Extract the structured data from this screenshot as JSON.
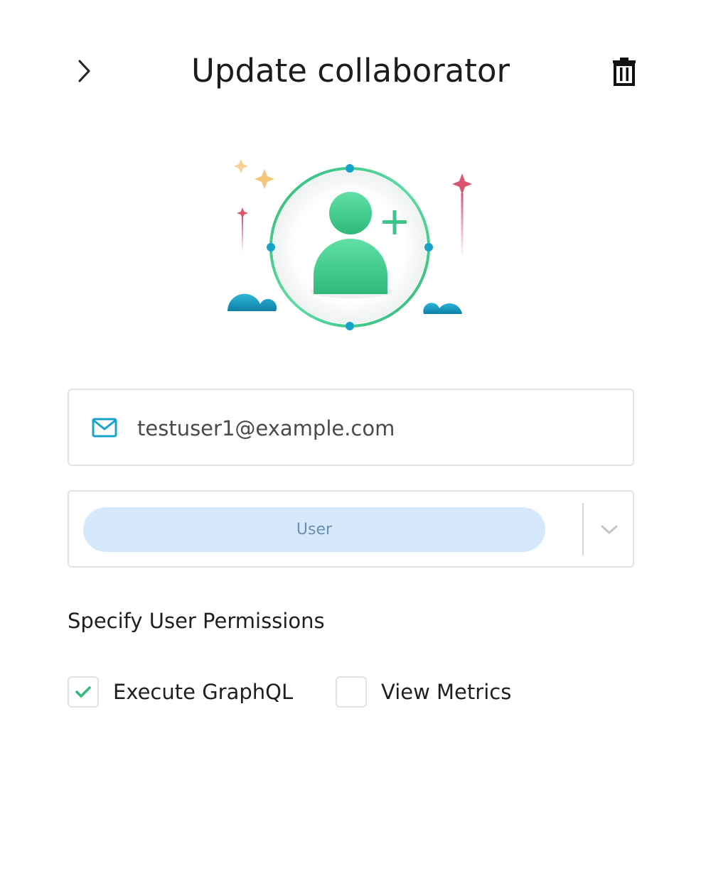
{
  "header": {
    "title": "Update collaborator",
    "back_icon": "chevron-right-icon",
    "delete_icon": "trash-icon"
  },
  "illustration": {
    "icon": "add-user-icon",
    "colors": {
      "green": "#3cc68a",
      "teal": "#1aa3c9",
      "pink": "#d9566e",
      "gold": "#f4c77a"
    }
  },
  "email": {
    "icon": "mail-icon",
    "value": "testuser1@example.com",
    "placeholder": ""
  },
  "role": {
    "selected": "User",
    "dropdown_icon": "chevron-down-icon"
  },
  "permissions": {
    "heading": "Specify User Permissions",
    "options": [
      {
        "label": "Execute GraphQL",
        "checked": true
      },
      {
        "label": "View Metrics",
        "checked": false
      }
    ]
  }
}
